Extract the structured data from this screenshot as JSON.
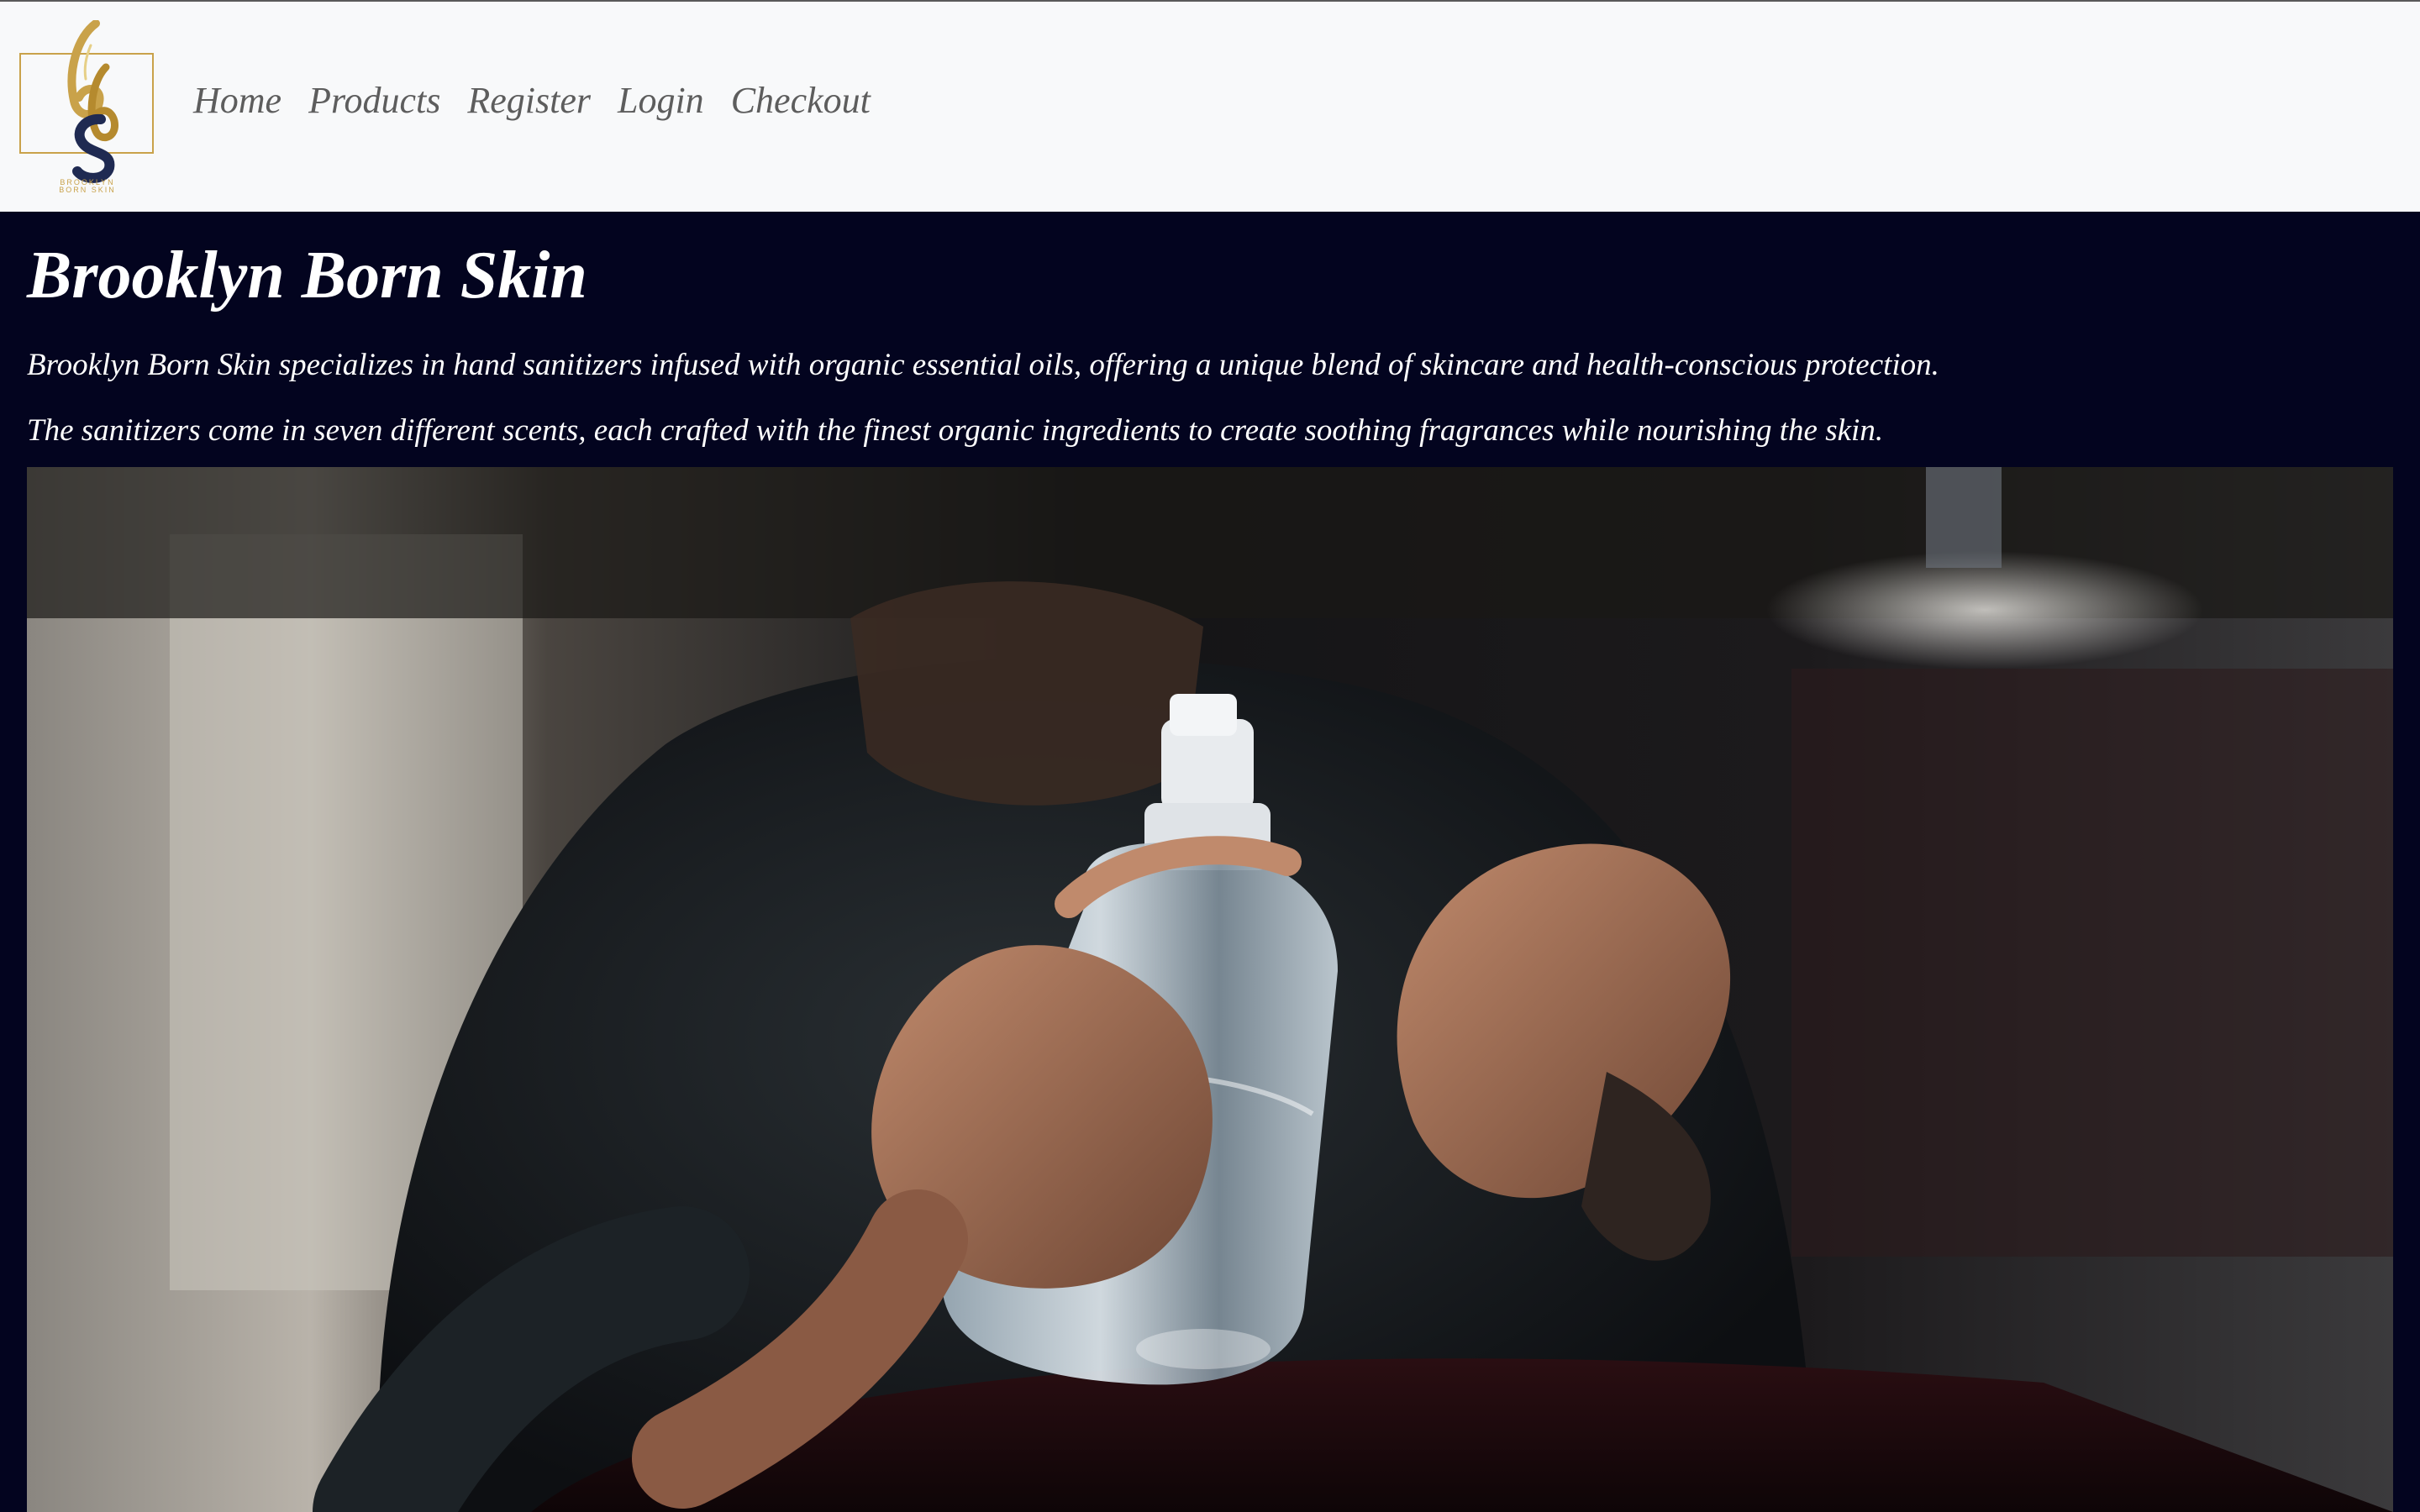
{
  "navbar": {
    "logo_alt": "Brooklyn Born Skin logo",
    "logo_caption_line1": "BROOKLYN",
    "logo_caption_line2": "BORN SKIN",
    "links": [
      "Home",
      "Products",
      "Register",
      "Login",
      "Checkout"
    ]
  },
  "hero": {
    "title": "Brooklyn Born Skin",
    "paragraph1": "Brooklyn Born Skin specializes in hand sanitizers infused with organic essential oils, offering a unique blend of skincare and health-conscious protection.",
    "paragraph2": "The sanitizers come in seven different scents, each crafted with the finest organic ingredients to create soothing fragrances while nourishing the skin.",
    "image_alt": "Person spraying hand sanitizer onto their hand"
  },
  "colors": {
    "navbar_bg": "#f8f9fa",
    "nav_link": "#5d5d5d",
    "page_bg": "#03041f",
    "text": "#ffffff",
    "logo_gold": "#c9a24a",
    "logo_navy": "#1f2a52"
  }
}
